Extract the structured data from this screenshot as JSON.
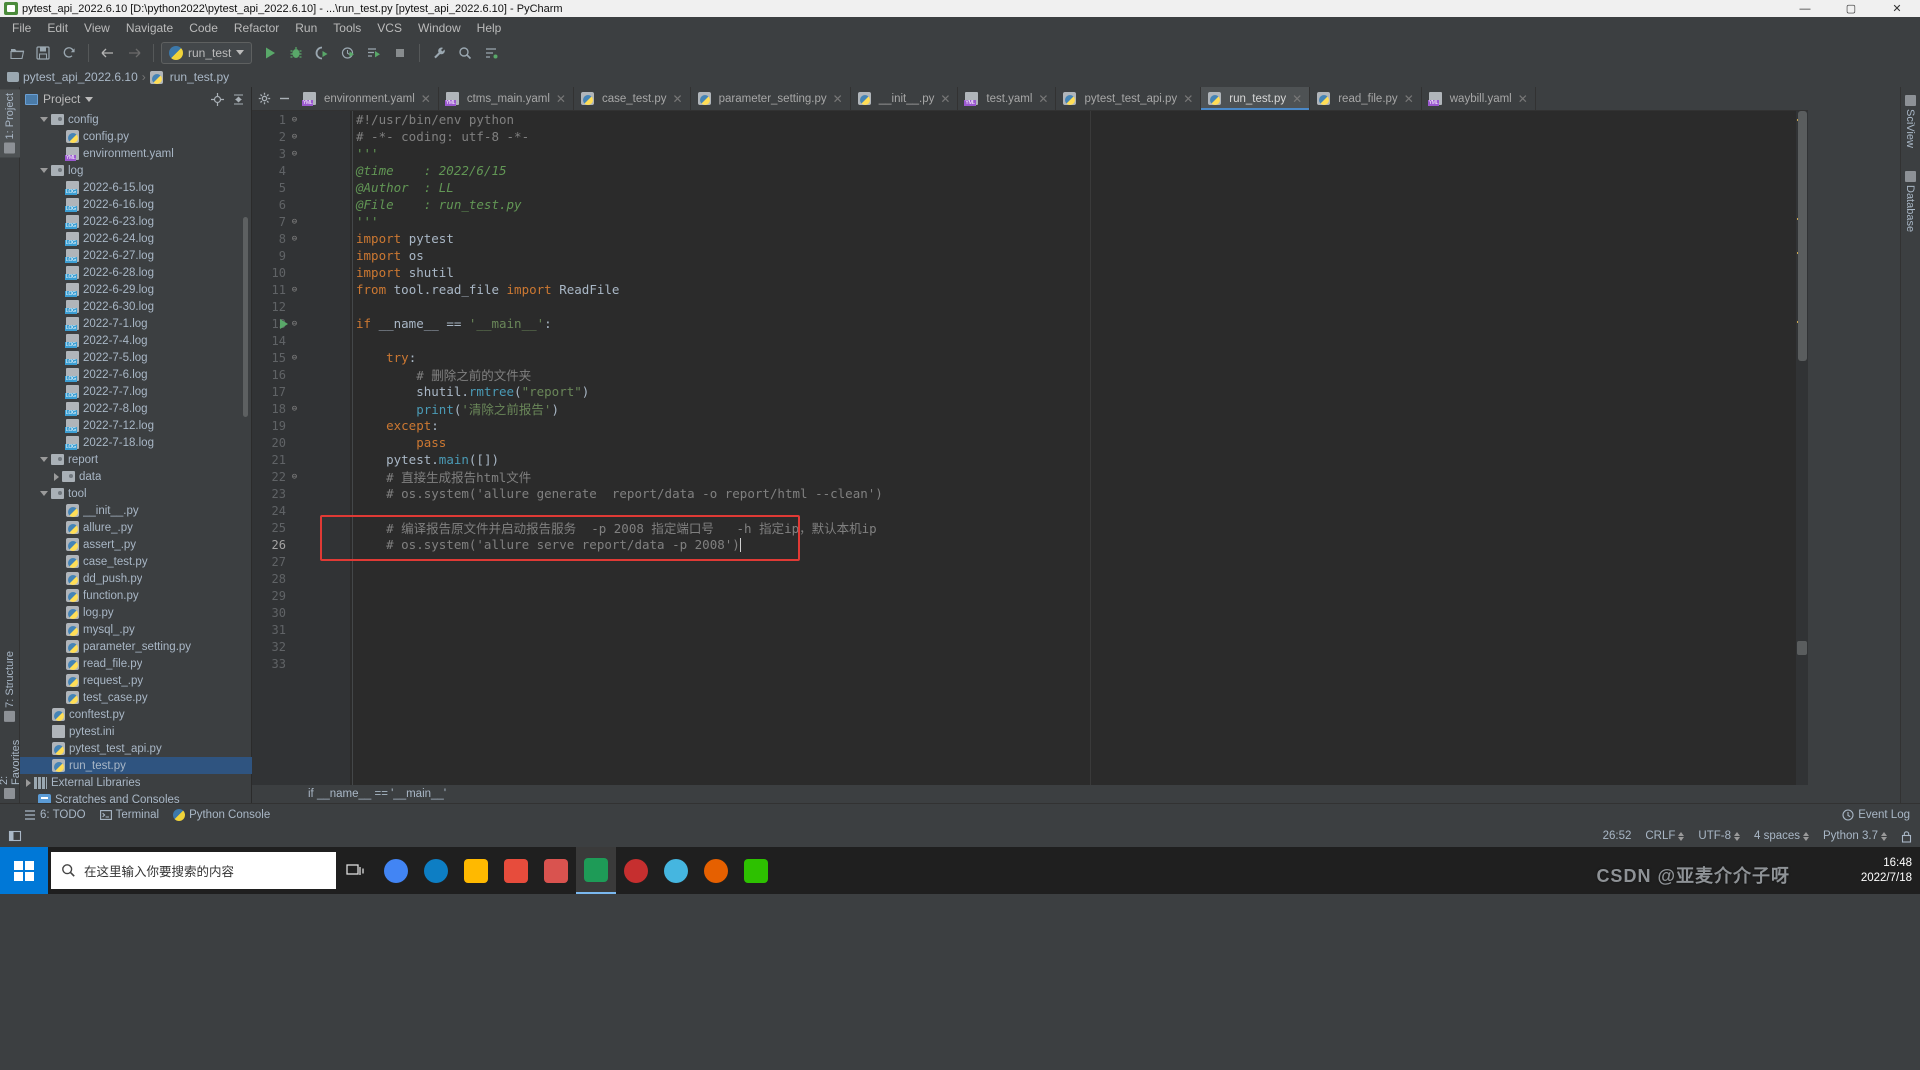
{
  "window": {
    "title": "pytest_api_2022.6.10 [D:\\python2022\\pytest_api_2022.6.10] - ...\\run_test.py [pytest_api_2022.6.10] - PyCharm",
    "minimize": "—",
    "maximize": "▢",
    "close": "✕"
  },
  "menu": [
    "File",
    "Edit",
    "View",
    "Navigate",
    "Code",
    "Refactor",
    "Run",
    "Tools",
    "VCS",
    "Window",
    "Help"
  ],
  "toolbar": {
    "open_icon": "open-folder-icon",
    "save_icon": "save-icon",
    "sync_icon": "sync-icon",
    "back_icon": "back-arrow-icon",
    "forward_icon": "forward-arrow-icon",
    "run_config": "run_test",
    "run_icon": "run-icon",
    "debug_icon": "debug-icon",
    "coverage_icon": "run-with-coverage-icon",
    "profile_icon": "profile-icon",
    "rerun_icon": "rerun-tests-icon",
    "stop_icon": "stop-icon",
    "settings_icon": "wrench-icon",
    "search_icon": "search-everywhere-icon",
    "structure_icon": "structure-icon"
  },
  "breadcrumb": {
    "project": "pytest_api_2022.6.10",
    "separator": "›",
    "file": "run_test.py"
  },
  "left_stripe": [
    {
      "label": "1: Project",
      "icon": "project-icon",
      "selected": true
    },
    {
      "label": "7: Structure",
      "icon": "structure-icon",
      "selected": false
    },
    {
      "label": "2: Favorites",
      "icon": "favorites-icon",
      "selected": false
    }
  ],
  "right_stripe": [
    {
      "label": "SciView",
      "icon": "sciview-icon"
    },
    {
      "label": "Database",
      "icon": "database-icon"
    }
  ],
  "project_panel": {
    "title": "Project",
    "dropdown_icon": "chevron-down-icon",
    "locate_icon": "scroll-from-source-icon",
    "collapse_icon": "collapse-all-icon",
    "tree": [
      {
        "label": "config",
        "type": "folder",
        "depth": 1,
        "state": "open"
      },
      {
        "label": "config.py",
        "type": "py",
        "depth": 2,
        "state": "leaf"
      },
      {
        "label": "environment.yaml",
        "type": "yml",
        "depth": 2,
        "state": "leaf"
      },
      {
        "label": "log",
        "type": "folder",
        "depth": 1,
        "state": "open"
      },
      {
        "label": "2022-6-15.log",
        "type": "log",
        "depth": 2,
        "state": "leaf"
      },
      {
        "label": "2022-6-16.log",
        "type": "log",
        "depth": 2,
        "state": "leaf"
      },
      {
        "label": "2022-6-23.log",
        "type": "log",
        "depth": 2,
        "state": "leaf"
      },
      {
        "label": "2022-6-24.log",
        "type": "log",
        "depth": 2,
        "state": "leaf"
      },
      {
        "label": "2022-6-27.log",
        "type": "log",
        "depth": 2,
        "state": "leaf"
      },
      {
        "label": "2022-6-28.log",
        "type": "log",
        "depth": 2,
        "state": "leaf"
      },
      {
        "label": "2022-6-29.log",
        "type": "log",
        "depth": 2,
        "state": "leaf"
      },
      {
        "label": "2022-6-30.log",
        "type": "log",
        "depth": 2,
        "state": "leaf"
      },
      {
        "label": "2022-7-1.log",
        "type": "log",
        "depth": 2,
        "state": "leaf"
      },
      {
        "label": "2022-7-4.log",
        "type": "log",
        "depth": 2,
        "state": "leaf"
      },
      {
        "label": "2022-7-5.log",
        "type": "log",
        "depth": 2,
        "state": "leaf"
      },
      {
        "label": "2022-7-6.log",
        "type": "log",
        "depth": 2,
        "state": "leaf"
      },
      {
        "label": "2022-7-7.log",
        "type": "log",
        "depth": 2,
        "state": "leaf"
      },
      {
        "label": "2022-7-8.log",
        "type": "log",
        "depth": 2,
        "state": "leaf"
      },
      {
        "label": "2022-7-12.log",
        "type": "log",
        "depth": 2,
        "state": "leaf"
      },
      {
        "label": "2022-7-18.log",
        "type": "log",
        "depth": 2,
        "state": "leaf"
      },
      {
        "label": "report",
        "type": "folder",
        "depth": 1,
        "state": "open"
      },
      {
        "label": "data",
        "type": "folder",
        "depth": 2,
        "state": "closed"
      },
      {
        "label": "tool",
        "type": "folder",
        "depth": 1,
        "state": "open"
      },
      {
        "label": "__init__.py",
        "type": "py",
        "depth": 2,
        "state": "leaf"
      },
      {
        "label": "allure_.py",
        "type": "py",
        "depth": 2,
        "state": "leaf"
      },
      {
        "label": "assert_.py",
        "type": "py",
        "depth": 2,
        "state": "leaf"
      },
      {
        "label": "case_test.py",
        "type": "py",
        "depth": 2,
        "state": "leaf"
      },
      {
        "label": "dd_push.py",
        "type": "py",
        "depth": 2,
        "state": "leaf"
      },
      {
        "label": "function.py",
        "type": "py",
        "depth": 2,
        "state": "leaf"
      },
      {
        "label": "log.py",
        "type": "py",
        "depth": 2,
        "state": "leaf"
      },
      {
        "label": "mysql_.py",
        "type": "py",
        "depth": 2,
        "state": "leaf"
      },
      {
        "label": "parameter_setting.py",
        "type": "py",
        "depth": 2,
        "state": "leaf"
      },
      {
        "label": "read_file.py",
        "type": "py",
        "depth": 2,
        "state": "leaf"
      },
      {
        "label": "request_.py",
        "type": "py",
        "depth": 2,
        "state": "leaf"
      },
      {
        "label": "test_case.py",
        "type": "py",
        "depth": 2,
        "state": "leaf"
      },
      {
        "label": "conftest.py",
        "type": "py",
        "depth": 1,
        "state": "leaf"
      },
      {
        "label": "pytest.ini",
        "type": "ini",
        "depth": 1,
        "state": "leaf"
      },
      {
        "label": "pytest_test_api.py",
        "type": "py",
        "depth": 1,
        "state": "leaf"
      },
      {
        "label": "run_test.py",
        "type": "py",
        "depth": 1,
        "state": "leaf",
        "selected": true
      },
      {
        "label": "External Libraries",
        "type": "lib",
        "depth": 0,
        "state": "closed"
      },
      {
        "label": "Scratches and Consoles",
        "type": "scratch",
        "depth": 0,
        "state": "leaf"
      }
    ]
  },
  "editor_tabs": {
    "gear_icon": "gear-icon",
    "minimize_icon": "minimize-icon",
    "items": [
      {
        "label": "environment.yaml",
        "type": "yml",
        "active": false
      },
      {
        "label": "ctms_main.yaml",
        "type": "yml",
        "active": false
      },
      {
        "label": "case_test.py",
        "type": "py",
        "active": false
      },
      {
        "label": "parameter_setting.py",
        "type": "py",
        "active": false
      },
      {
        "label": "__init__.py",
        "type": "py",
        "active": false
      },
      {
        "label": "test.yaml",
        "type": "yml",
        "active": false
      },
      {
        "label": "pytest_test_api.py",
        "type": "py",
        "active": false
      },
      {
        "label": "run_test.py",
        "type": "py",
        "active": true
      },
      {
        "label": "read_file.py",
        "type": "py",
        "active": false
      },
      {
        "label": "waybill.yaml",
        "type": "yml",
        "active": false
      }
    ],
    "close_icon": "close-icon"
  },
  "code": {
    "lines": [
      {
        "n": 1,
        "fold": "⊖",
        "tokens": [
          {
            "t": "#!/usr/bin/env python",
            "c": "c-cmt"
          }
        ]
      },
      {
        "n": 2,
        "fold": "⊖",
        "tokens": [
          {
            "t": "# -*- coding: utf-8 -*-",
            "c": "c-cmt"
          }
        ]
      },
      {
        "n": 3,
        "fold": "⊖",
        "tokens": [
          {
            "t": "'''",
            "c": "c-doc"
          }
        ]
      },
      {
        "n": 4,
        "fold": "",
        "tokens": [
          {
            "t": "@time    : 2022/6/15",
            "c": "c-doc"
          }
        ]
      },
      {
        "n": 5,
        "fold": "",
        "tokens": [
          {
            "t": "@Author  : LL",
            "c": "c-doc"
          }
        ]
      },
      {
        "n": 6,
        "fold": "",
        "tokens": [
          {
            "t": "@File    : run_test.py",
            "c": "c-doc"
          }
        ]
      },
      {
        "n": 7,
        "fold": "⊖",
        "tokens": [
          {
            "t": "'''",
            "c": "c-doc"
          }
        ]
      },
      {
        "n": 8,
        "fold": "⊖",
        "tokens": [
          {
            "t": "import ",
            "c": "c-kw"
          },
          {
            "t": "pytest",
            "c": "c-def"
          }
        ]
      },
      {
        "n": 9,
        "fold": "",
        "tokens": [
          {
            "t": "import ",
            "c": "c-kw"
          },
          {
            "t": "os",
            "c": "c-def"
          }
        ]
      },
      {
        "n": 10,
        "fold": "",
        "tokens": [
          {
            "t": "import ",
            "c": "c-kw"
          },
          {
            "t": "shutil",
            "c": "c-def"
          }
        ]
      },
      {
        "n": 11,
        "fold": "⊖",
        "tokens": [
          {
            "t": "from ",
            "c": "c-kw"
          },
          {
            "t": "tool.read_file ",
            "c": "c-def"
          },
          {
            "t": "import ",
            "c": "c-kw"
          },
          {
            "t": "ReadFile",
            "c": "c-def"
          }
        ]
      },
      {
        "n": 12,
        "fold": "",
        "tokens": []
      },
      {
        "n": 13,
        "fold": "⊖",
        "run": true,
        "tokens": [
          {
            "t": "if ",
            "c": "c-kw"
          },
          {
            "t": "__name__ ",
            "c": "c-def"
          },
          {
            "t": "== ",
            "c": "c-def"
          },
          {
            "t": "'__main__'",
            "c": "c-str"
          },
          {
            "t": ":",
            "c": "c-def"
          }
        ]
      },
      {
        "n": 14,
        "fold": "",
        "tokens": []
      },
      {
        "n": 15,
        "fold": "⊖",
        "tokens": [
          {
            "t": "    try",
            "c": "c-kw"
          },
          {
            "t": ":",
            "c": "c-def"
          }
        ]
      },
      {
        "n": 16,
        "fold": "",
        "tokens": [
          {
            "t": "        # 删除之前的文件夹",
            "c": "c-cmt"
          }
        ]
      },
      {
        "n": 17,
        "fold": "",
        "tokens": [
          {
            "t": "        shutil.",
            "c": "c-def"
          },
          {
            "t": "rmtree",
            "c": "c-meth"
          },
          {
            "t": "(",
            "c": "c-def"
          },
          {
            "t": "\"report\"",
            "c": "c-str"
          },
          {
            "t": ")",
            "c": "c-def"
          }
        ]
      },
      {
        "n": 18,
        "fold": "⊖",
        "tokens": [
          {
            "t": "        ",
            "c": "c-def"
          },
          {
            "t": "print",
            "c": "c-meth"
          },
          {
            "t": "(",
            "c": "c-def"
          },
          {
            "t": "'清除之前报告'",
            "c": "c-str"
          },
          {
            "t": ")",
            "c": "c-def"
          }
        ]
      },
      {
        "n": 19,
        "fold": "",
        "tokens": [
          {
            "t": "    except",
            "c": "c-kw"
          },
          {
            "t": ":",
            "c": "c-def"
          }
        ]
      },
      {
        "n": 20,
        "fold": "",
        "tokens": [
          {
            "t": "        pass",
            "c": "c-kw"
          }
        ]
      },
      {
        "n": 21,
        "fold": "",
        "tokens": [
          {
            "t": "    pytest.",
            "c": "c-def"
          },
          {
            "t": "main",
            "c": "c-meth"
          },
          {
            "t": "([])",
            "c": "c-def"
          }
        ]
      },
      {
        "n": 22,
        "fold": "⊖",
        "tokens": [
          {
            "t": "    # 直接生成报告html文件",
            "c": "c-cmt"
          }
        ]
      },
      {
        "n": 23,
        "fold": "",
        "tokens": [
          {
            "t": "    # os.system('allure generate  report/data -o report/html --clean')",
            "c": "c-cmt"
          }
        ]
      },
      {
        "n": 24,
        "fold": "",
        "tokens": []
      },
      {
        "n": 25,
        "fold": "",
        "tokens": [
          {
            "t": "    # 编译报告原文件并启动报告服务  -p 2008 指定端口号   -h 指定ip，默认本机ip",
            "c": "c-cmt"
          }
        ]
      },
      {
        "n": 26,
        "fold": "",
        "cur": true,
        "caret": true,
        "tokens": [
          {
            "t": "    # os.system('allure serve report/data -p 2008')",
            "c": "c-cmt"
          }
        ]
      },
      {
        "n": 27,
        "fold": "",
        "tokens": []
      },
      {
        "n": 28,
        "fold": "",
        "tokens": []
      },
      {
        "n": 29,
        "fold": "",
        "tokens": []
      },
      {
        "n": 30,
        "fold": "",
        "tokens": []
      },
      {
        "n": 31,
        "fold": "",
        "tokens": []
      },
      {
        "n": 32,
        "fold": "",
        "tokens": []
      },
      {
        "n": 33,
        "fold": "",
        "tokens": []
      }
    ],
    "bottom_breadcrumb": "if __name__ == '__main__'",
    "highlight_color": "#e03a35"
  },
  "bottom_toolbar": {
    "todo": "6: TODO",
    "todo_icon": "todo-icon",
    "terminal": "Terminal",
    "terminal_icon": "terminal-icon",
    "python_console": "Python Console",
    "python_console_icon": "python-console-icon",
    "event_log": "Event Log",
    "event_log_icon": "event-log-icon"
  },
  "status_bar": {
    "caret_position": "26:52",
    "line_separator": "CRLF",
    "encoding": "UTF-8",
    "indent": "4 spaces",
    "interpreter": "Python 3.7",
    "lock_icon": "lock-icon",
    "branch_icon": "git-branch-icon"
  },
  "taskbar": {
    "search_placeholder": "在这里输入你要搜索的内容",
    "search_icon": "search-icon",
    "start_icon": "windows-start-icon",
    "taskview_icon": "task-view-icon",
    "apps": [
      {
        "name": "chrome-icon",
        "color": "#4285f4"
      },
      {
        "name": "edge-icon",
        "color": "#0d7ec4"
      },
      {
        "name": "file-explorer-icon",
        "color": "#ffb900"
      },
      {
        "name": "xmind-icon",
        "color": "#e74c3c"
      },
      {
        "name": "wps-writer-icon",
        "color": "#d9534f"
      },
      {
        "name": "wps-spreadsheet-icon",
        "color": "#1e9b57"
      },
      {
        "name": "netease-music-icon",
        "color": "#c62f2f"
      },
      {
        "name": "qq-icon",
        "color": "#45b6e0"
      },
      {
        "name": "firefox-icon",
        "color": "#e66000"
      },
      {
        "name": "wechat-icon",
        "color": "#2dc100"
      }
    ],
    "clock_time": "16:48",
    "clock_date": "2022/7/18"
  },
  "watermark": "CSDN @亚麦介介子呀"
}
